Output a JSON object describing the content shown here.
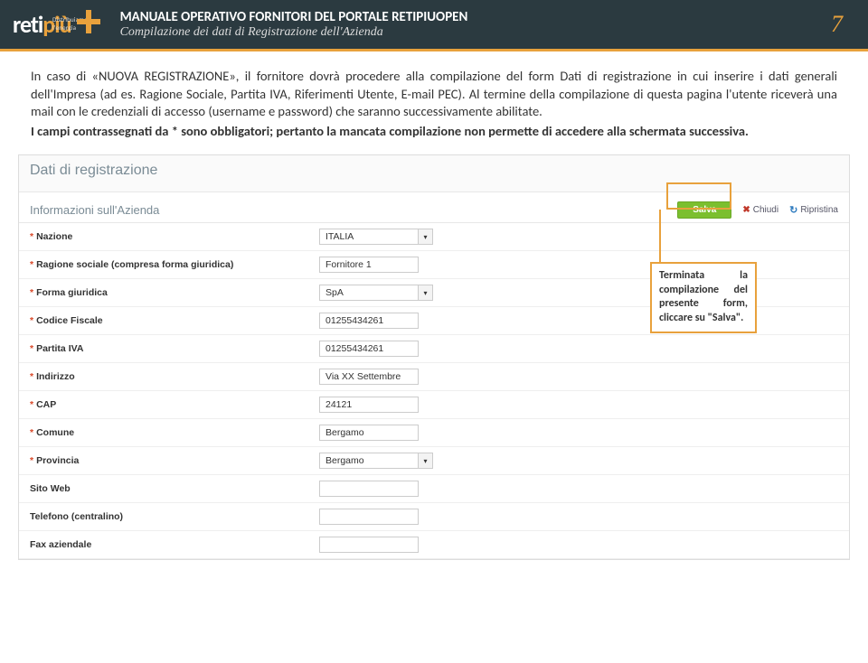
{
  "header": {
    "tagline": "Distribuiamo l'energia",
    "brand_a": "reti",
    "brand_b": "più",
    "title": "MANUALE OPERATIVO FORNITORI DEL PORTALE RETIPIUOPEN",
    "subtitle": "Compilazione dei dati di Registrazione dell'Azienda",
    "page": "7"
  },
  "body": {
    "p1_a": "In caso di «NUOVA REGISTRAZIONE», il fornitore dovrà procedere alla compilazione del form Dati di registrazione in cui inserire i dati generali dell'Impresa (ad es. Ragione Sociale, Partita IVA, Riferimenti Utente, E-mail PEC). Al termine della compilazione di questa pagina l'utente riceverà una mail con le credenziali di accesso (username e password) che saranno successivamente abilitate.",
    "p2_a": "I campi contrassegnati da * sono obbligatori; pertanto la mancata compilazione non permette di accedere alla schermata successiva."
  },
  "screenshot": {
    "heading": "Dati di registrazione",
    "section": "Informazioni sull'Azienda",
    "buttons": {
      "save": "Salva",
      "close": "Chiudi",
      "restore": "Ripristina"
    },
    "fields": [
      {
        "label": "Nazione",
        "required": true,
        "value": "ITALIA",
        "type": "select"
      },
      {
        "label": "Ragione sociale (compresa forma giuridica)",
        "required": true,
        "value": "Fornitore 1",
        "type": "text"
      },
      {
        "label": "Forma giuridica",
        "required": true,
        "value": "SpA",
        "type": "select"
      },
      {
        "label": "Codice Fiscale",
        "required": true,
        "value": "01255434261",
        "type": "text"
      },
      {
        "label": "Partita IVA",
        "required": true,
        "value": "01255434261",
        "type": "text"
      },
      {
        "label": "Indirizzo",
        "required": true,
        "value": "Via XX Settembre",
        "type": "text"
      },
      {
        "label": "CAP",
        "required": true,
        "value": "24121",
        "type": "text"
      },
      {
        "label": "Comune",
        "required": true,
        "value": "Bergamo",
        "type": "text"
      },
      {
        "label": "Provincia",
        "required": true,
        "value": "Bergamo",
        "type": "select"
      },
      {
        "label": "Sito Web",
        "required": false,
        "value": "",
        "type": "text"
      },
      {
        "label": "Telefono (centralino)",
        "required": false,
        "value": "",
        "type": "text"
      },
      {
        "label": "Fax aziendale",
        "required": false,
        "value": "",
        "type": "text"
      }
    ]
  },
  "callout": {
    "text": "Terminata la compilazione del presente form, cliccare su \"Salva\"."
  }
}
